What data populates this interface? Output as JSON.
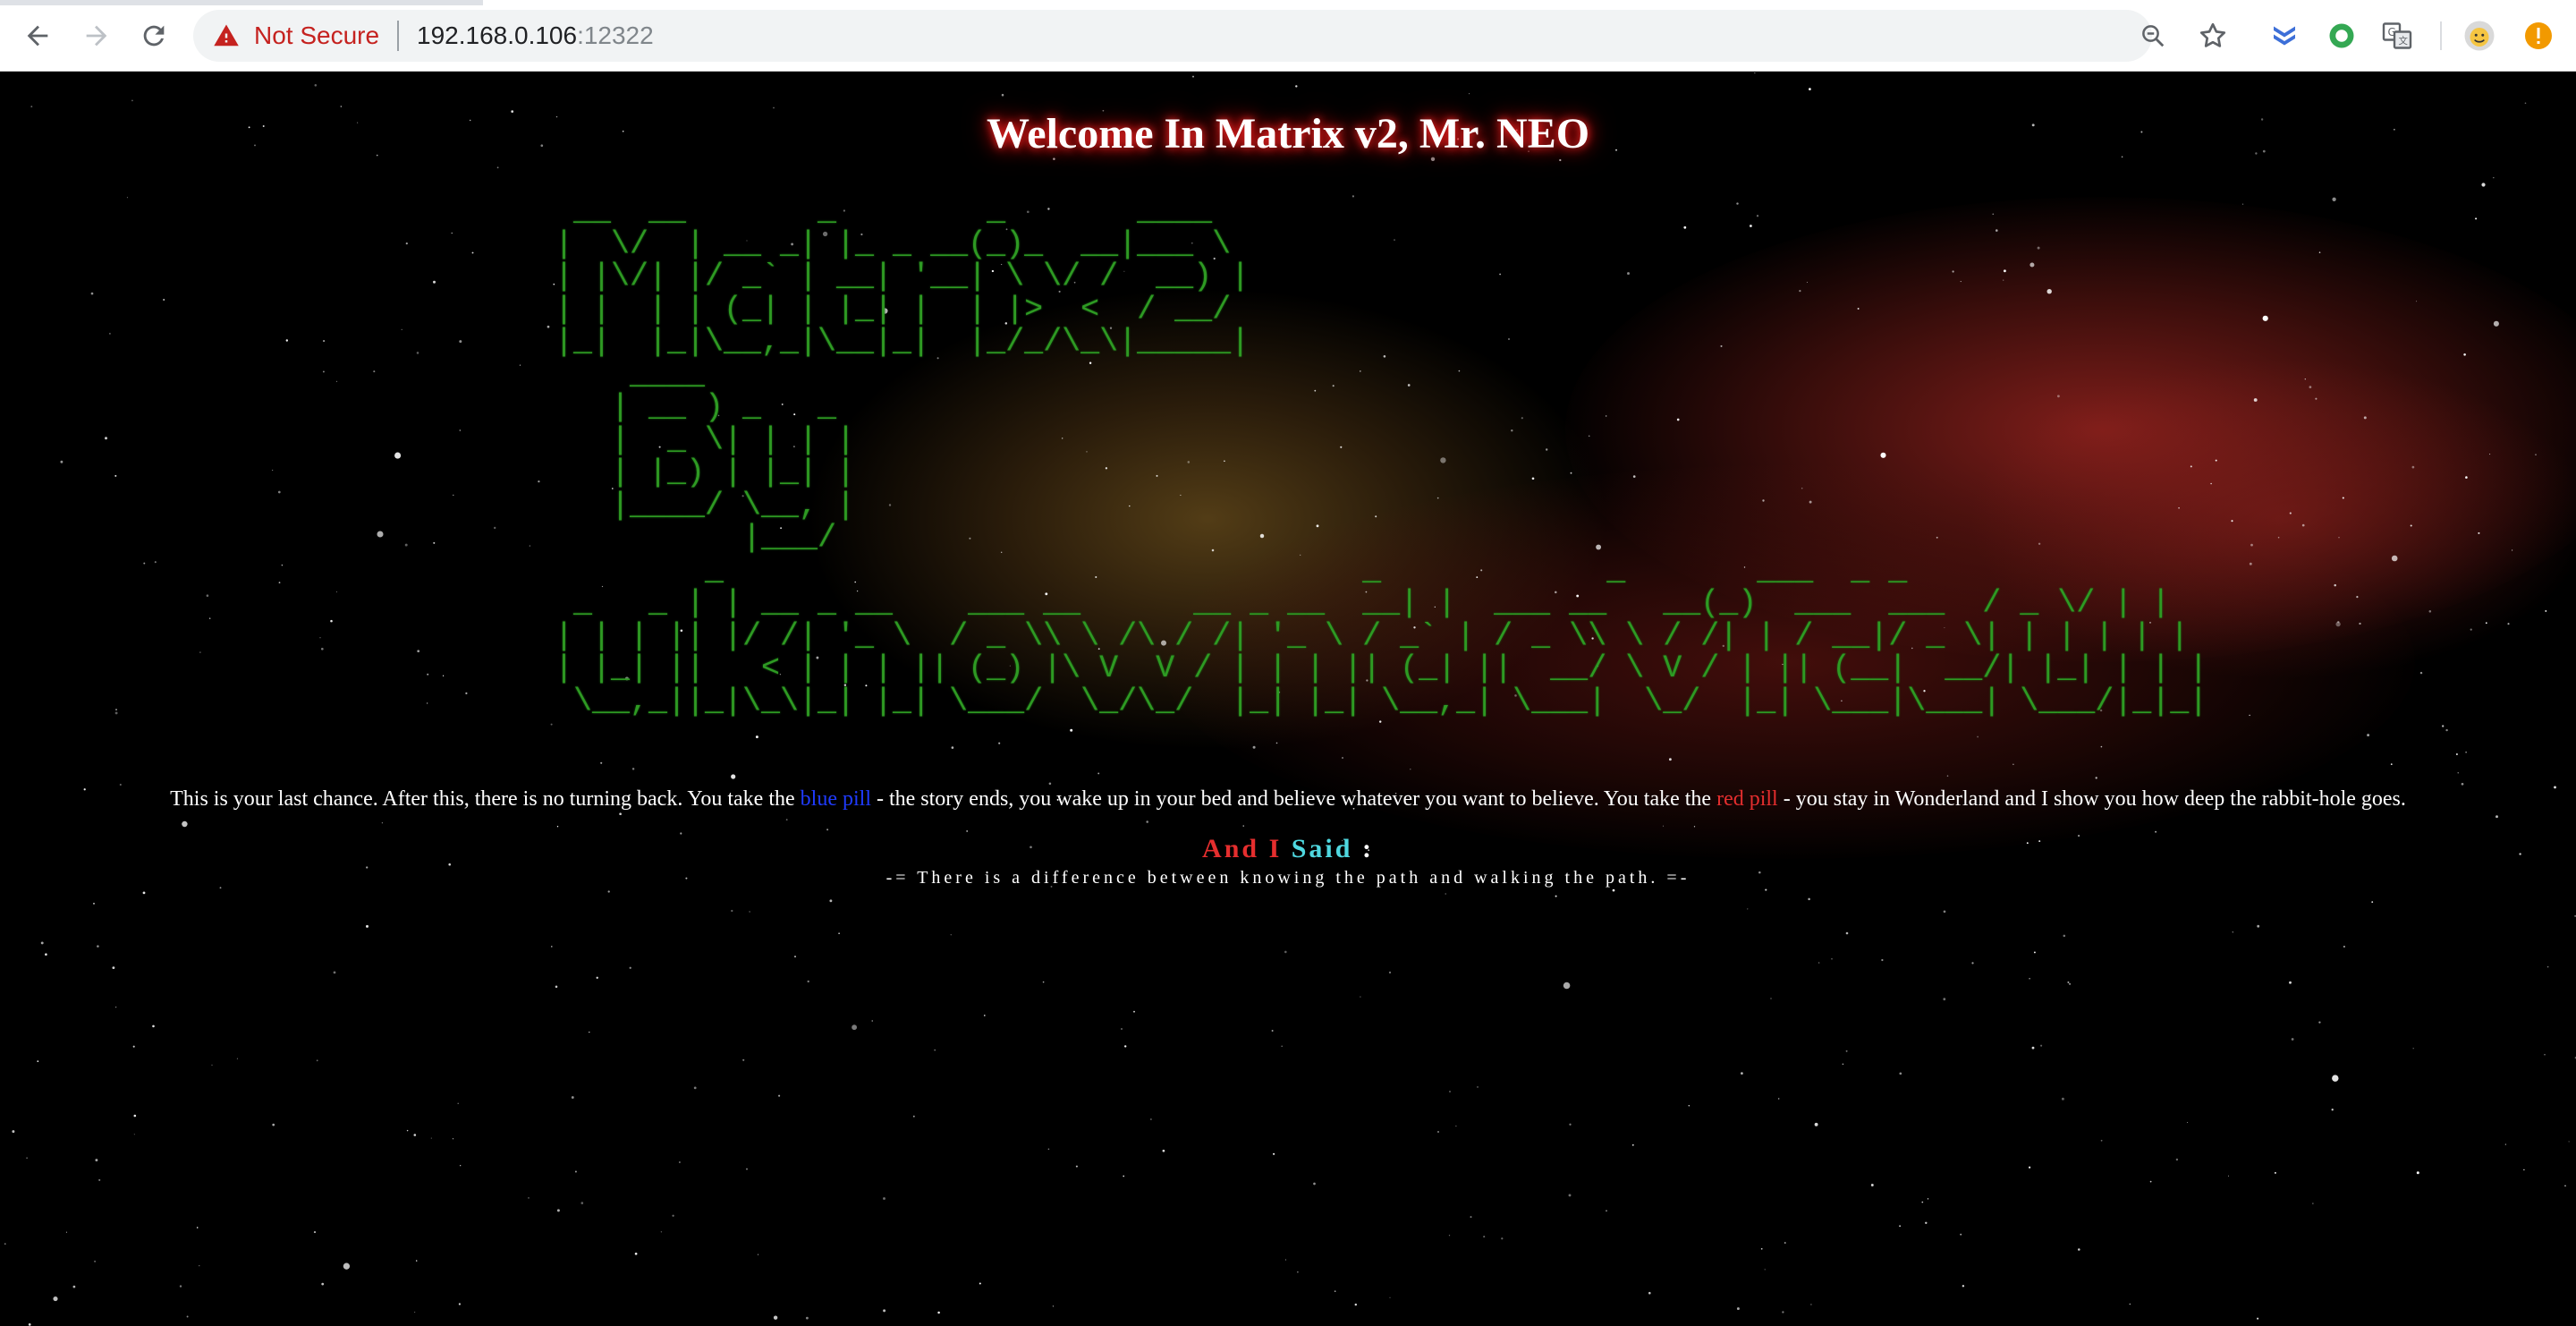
{
  "browser": {
    "security_label": "Not Secure",
    "url_host": "192.168.0.106",
    "url_port": ":12322",
    "icons": [
      "back-icon",
      "forward-icon",
      "reload-icon",
      "warning-icon",
      "zoom-out-icon",
      "star-icon",
      "extension-chevrons-icon",
      "extension-circle-icon",
      "translate-icon",
      "profile-avatar-icon",
      "update-alert-icon"
    ]
  },
  "page": {
    "welcome_title": "Welcome In Matrix v2, Mr. NEO",
    "ascii_art": " __  __       _        _       ____  \n|  \\/  | __ _| |_ _ __(_)_  __|___ \\ \n| |\\/| |/ _` | __| '__| \\ \\/ /  __) |\n| |  | | (_| | |_| |  | |>  <  / __/ \n|_|  |_|\\__,_|\\__|_|  |_/_/\\_\\|_____|\n    ____        \n   | __ ) _   _ \n   |  _ \\| | | |\n   | |_) | |_| |\n   |____/ \\__, |\n          |___/ \n        _                                  _            _       ___  _ _  \n _   _ | | __ _ __    ___ __      __ _ __  __| |  ___ __   __(_)  ___  ___  / _ \\/ | | \n| | | || |/ /| '_ \\  / _ \\\\ \\ /\\ / /| '_ \\ / _` | / _ \\\\ \\ / /| | / __|/ _ \\| | | | | | \n| |_| ||   < | | | || (_) |\\ V  V / | | | || (_| ||  __/ \\ V / | || (__|  __/| |_| | | | \n \\__,_||_|\\_\\|_| |_| \\___/  \\_/\\_/  |_| |_| \\__,_| \\___|  \\_/  |_| \\___|\\___| \\___/|_|_| ",
    "quote": {
      "part1": "This is your last chance. After this, there is no turning back. You take the ",
      "blue_pill": "blue pill",
      "part2": " - the story ends, you wake up in your bed and believe whatever you want to believe. You take the ",
      "red_pill": "red pill",
      "part3": " - you stay in Wonderland and I show you how deep the rabbit-hole goes."
    },
    "said": {
      "part1": "And I ",
      "part2": "Said",
      "part3": " :"
    },
    "motto": "-= There is a difference between knowing the path and walking the path. =-"
  },
  "colors": {
    "ascii_green": "#2e9a23",
    "blue_pill": "#1f3bff",
    "red_pill": "#e52e2e",
    "said_cyan": "#4fd8e0",
    "not_secure_red": "#c5221f"
  }
}
